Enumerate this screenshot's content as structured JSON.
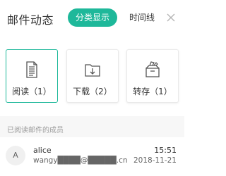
{
  "header": {
    "title": "邮件动态",
    "tabs": [
      {
        "label": "分类显示",
        "active": true
      },
      {
        "label": "时间线",
        "active": false
      }
    ],
    "close_icon": "close-icon"
  },
  "cards": [
    {
      "label": "阅读（1）",
      "icon": "document-icon",
      "selected": true
    },
    {
      "label": "下载（2）",
      "icon": "folder-download-icon",
      "selected": false
    },
    {
      "label": "转存（1）",
      "icon": "box-save-icon",
      "selected": false
    }
  ],
  "members_section": {
    "label": "已阅读邮件的成员",
    "members": [
      {
        "avatar_letter": "A",
        "name": "alice",
        "email": "wangy████@█████.cn",
        "time": "15:51",
        "date": "2018-11-21"
      }
    ]
  },
  "colors": {
    "accent": "#1eb89a",
    "text": "#333333",
    "muted": "#9a9a9a"
  }
}
